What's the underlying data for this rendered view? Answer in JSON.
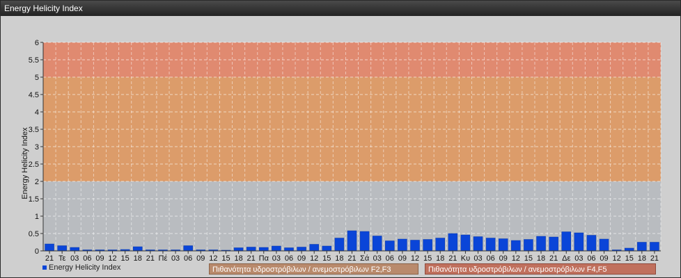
{
  "window": {
    "title": "Energy Helicity Index"
  },
  "chart_data": {
    "type": "bar",
    "title": "",
    "ylabel": "Energy Helicity Index",
    "xlabel": "",
    "ylim": [
      0,
      6
    ],
    "yticks": [
      "0",
      "0.5",
      "1",
      "1.5",
      "2",
      "2.5",
      "3",
      "3.5",
      "4",
      "4.5",
      "5",
      "5.5",
      "6"
    ],
    "categories": [
      "21",
      "Τε",
      "03",
      "06",
      "09",
      "12",
      "15",
      "18",
      "21",
      "Πέ",
      "03",
      "06",
      "09",
      "12",
      "15",
      "18",
      "21",
      "Πα",
      "03",
      "06",
      "09",
      "12",
      "15",
      "18",
      "21",
      "Σά",
      "03",
      "06",
      "09",
      "12",
      "15",
      "18",
      "21",
      "Κυ",
      "03",
      "06",
      "09",
      "12",
      "15",
      "18",
      "21",
      "Δε",
      "03",
      "06",
      "09",
      "12",
      "15",
      "18",
      "21"
    ],
    "series": [
      {
        "name": "Energy Helicity Index",
        "color": "#0a45d8",
        "values": [
          0.2,
          0.15,
          0.1,
          0.03,
          0.03,
          0.03,
          0.04,
          0.12,
          0.03,
          0.03,
          0.03,
          0.15,
          0.03,
          0.03,
          0.02,
          0.09,
          0.11,
          0.1,
          0.14,
          0.09,
          0.11,
          0.19,
          0.14,
          0.37,
          0.58,
          0.56,
          0.43,
          0.29,
          0.34,
          0.31,
          0.33,
          0.37,
          0.5,
          0.46,
          0.41,
          0.37,
          0.35,
          0.3,
          0.33,
          0.42,
          0.4,
          0.55,
          0.52,
          0.45,
          0.34,
          0.03,
          0.08,
          0.25,
          0.25
        ]
      }
    ],
    "bands": [
      {
        "from": 0,
        "to": 2,
        "color": "#b9bcc0"
      },
      {
        "from": 2,
        "to": 5,
        "color": "#dc9c6a",
        "label": "Πιθανότητα υδροστρόβιλων / ανεμοστρόβιλων F2,F3"
      },
      {
        "from": 5,
        "to": 6,
        "color": "#e08a70",
        "label": "Πιθανότητα υδροστρόβιλων / ανεμοστρόβιλων F4,F5"
      }
    ],
    "grid": true,
    "legend_position": "bottom-left"
  }
}
